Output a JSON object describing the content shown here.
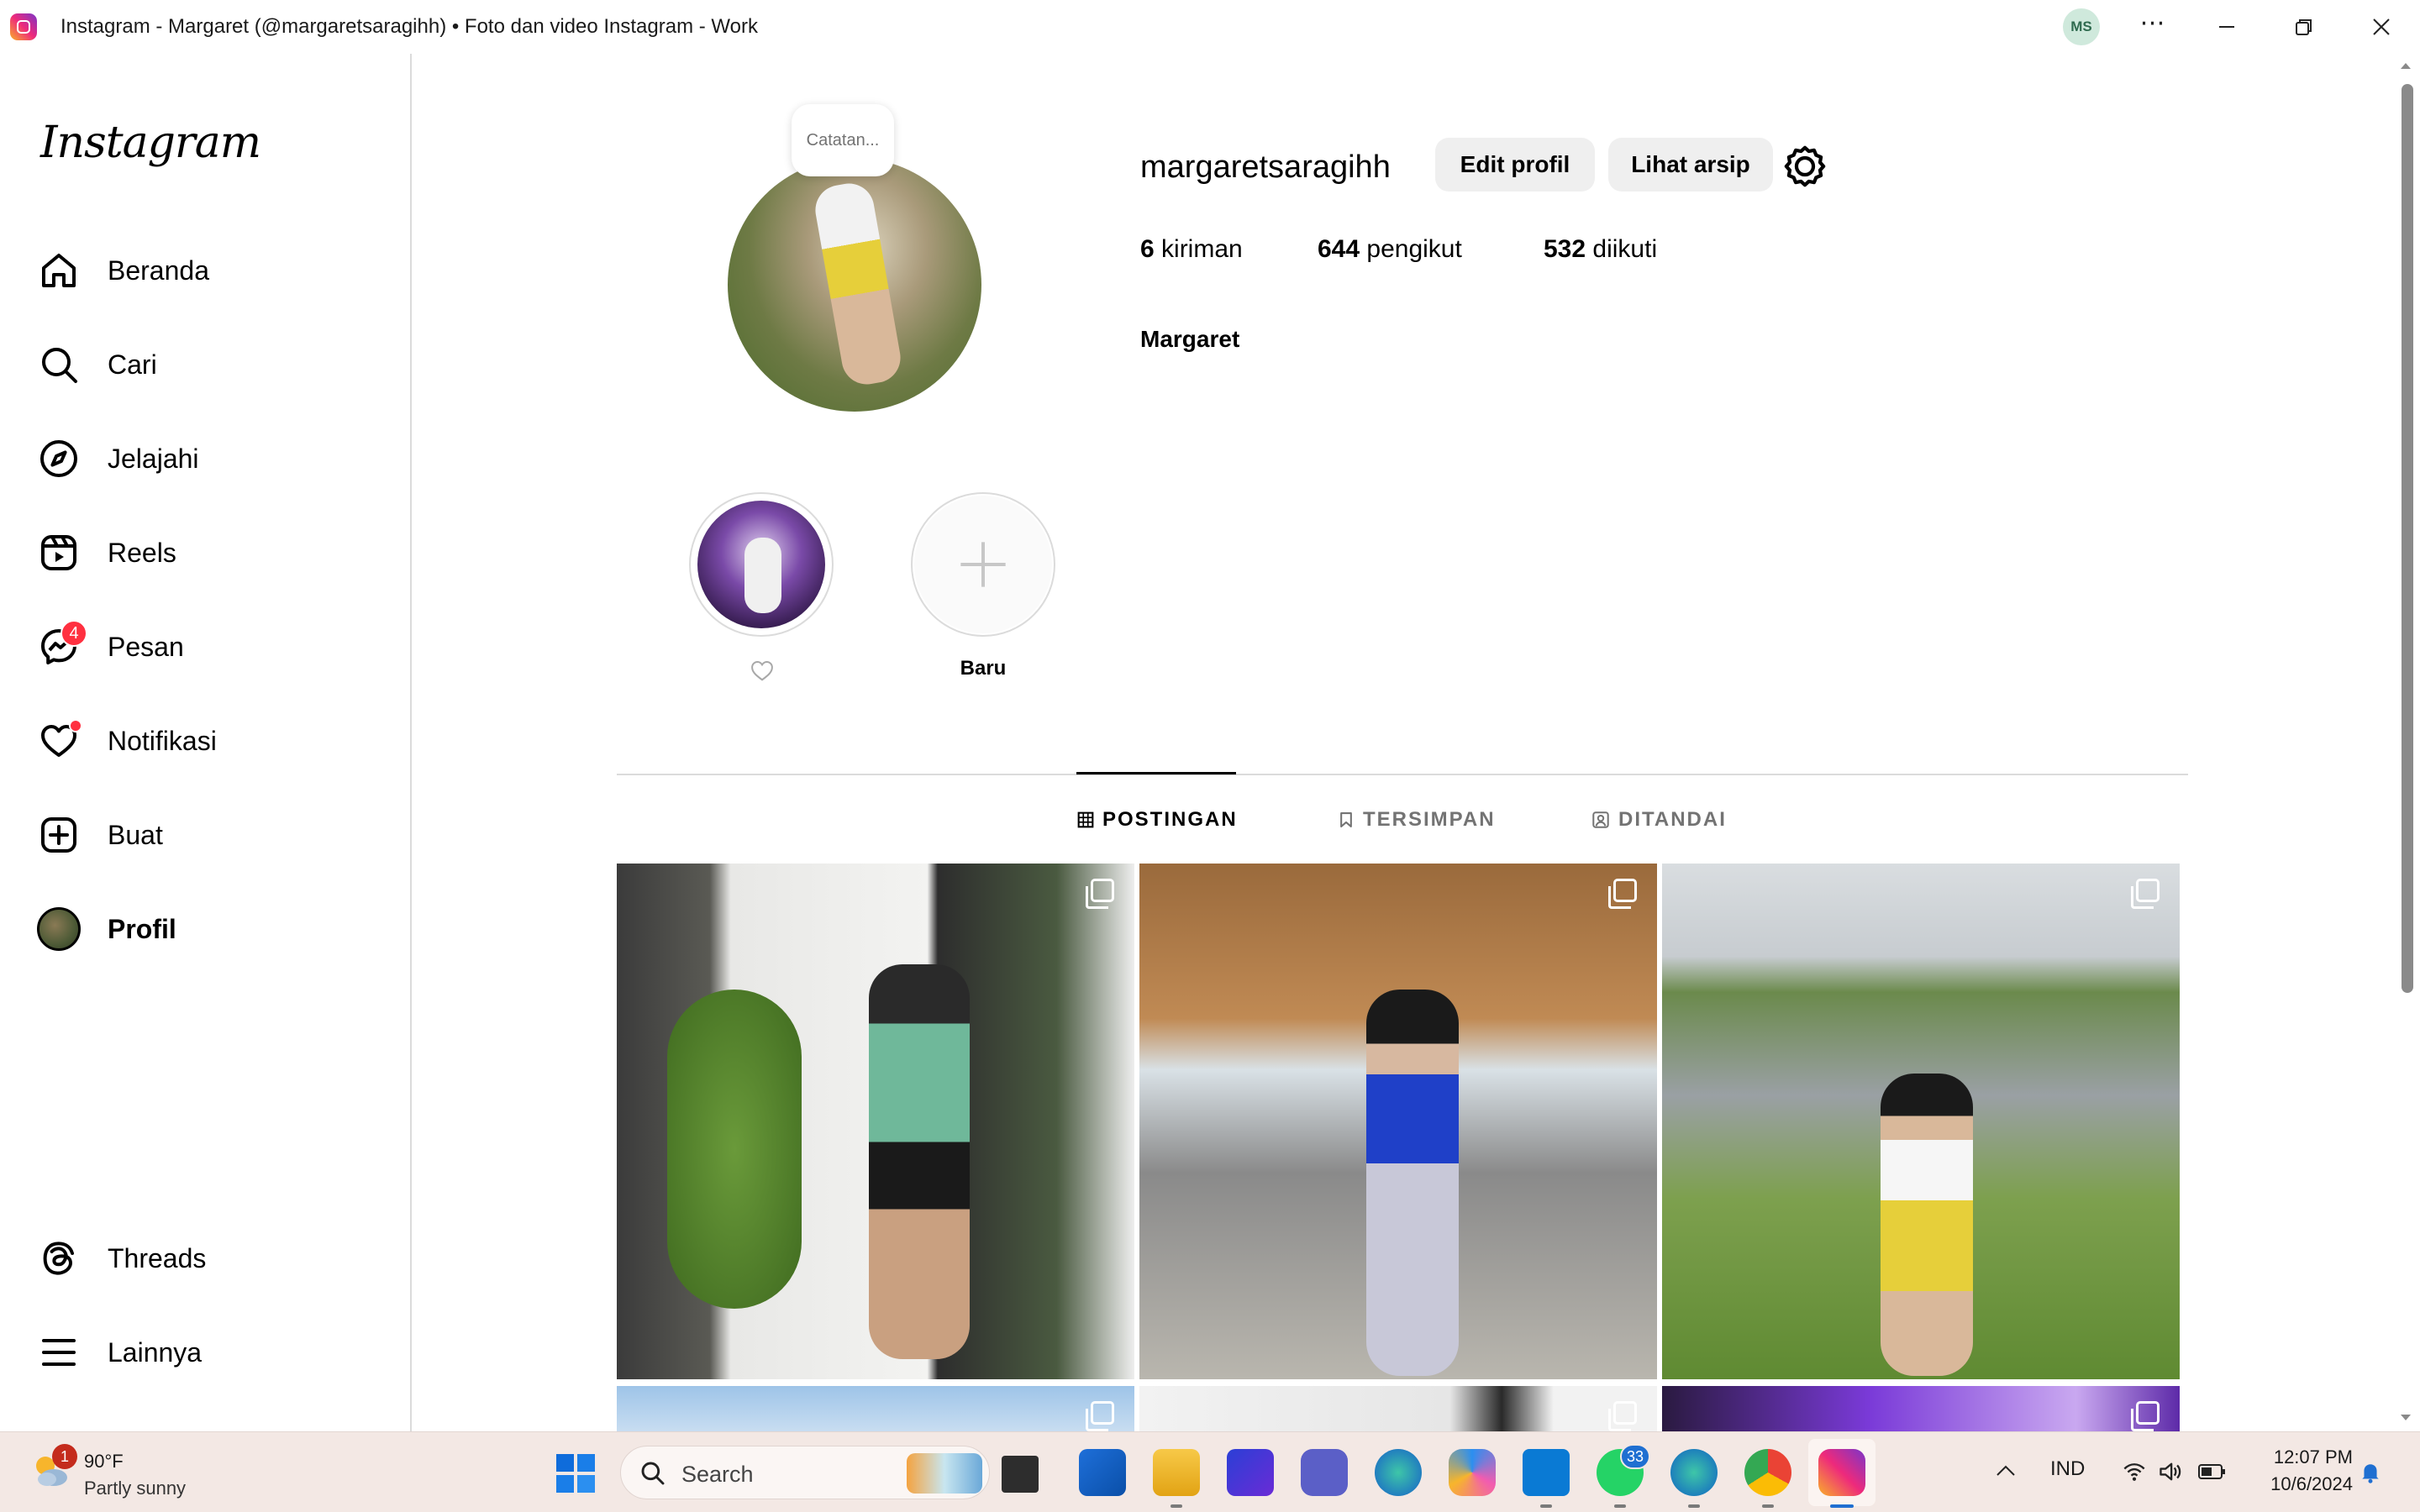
{
  "window": {
    "title": "Instagram - Margaret (@margaretsaragihh) • Foto dan video Instagram - Work",
    "profile_initials": "MS",
    "more_glyph": "⋯"
  },
  "sidebar": {
    "logo": "Instagram",
    "items": [
      {
        "label": "Beranda",
        "icon": "home-icon"
      },
      {
        "label": "Cari",
        "icon": "search-icon"
      },
      {
        "label": "Jelajahi",
        "icon": "compass-icon"
      },
      {
        "label": "Reels",
        "icon": "reels-icon"
      },
      {
        "label": "Pesan",
        "icon": "messenger-icon",
        "badge": "4"
      },
      {
        "label": "Notifikasi",
        "icon": "heart-icon",
        "dot": true
      },
      {
        "label": "Buat",
        "icon": "plus-square-icon"
      },
      {
        "label": "Profil",
        "icon": "avatar",
        "active": true
      }
    ],
    "bottom_items": [
      {
        "label": "Threads",
        "icon": "threads-icon"
      },
      {
        "label": "Lainnya",
        "icon": "menu-icon"
      }
    ]
  },
  "profile": {
    "note_placeholder": "Catatan...",
    "username": "margaretsaragihh",
    "edit_button": "Edit profil",
    "archive_button": "Lihat arsip",
    "stats": {
      "posts_count": "6",
      "posts_label": "kiriman",
      "followers_count": "644",
      "followers_label": "pengikut",
      "following_count": "532",
      "following_label": "diikuti"
    },
    "full_name": "Margaret"
  },
  "highlights": [
    {
      "label": "",
      "icon": "heart-outline-icon"
    },
    {
      "label": "Baru",
      "icon": "plus-icon"
    }
  ],
  "tabs": [
    {
      "label": "POSTINGAN",
      "icon": "grid-icon",
      "active": true
    },
    {
      "label": "TERSIMPAN",
      "icon": "bookmark-icon",
      "active": false
    },
    {
      "label": "DITANDAI",
      "icon": "tagged-icon",
      "active": false
    }
  ],
  "taskbar": {
    "weather_temp": "90°F",
    "weather_desc": "Partly sunny",
    "weather_badge": "1",
    "search_placeholder": "Search",
    "whatsapp_badge": "33",
    "language": "IND",
    "time": "12:07 PM",
    "date": "10/6/2024"
  },
  "colors": {
    "badge_red": "#ff3040",
    "border": "#dbdbdb",
    "button_gray": "#efefef"
  }
}
